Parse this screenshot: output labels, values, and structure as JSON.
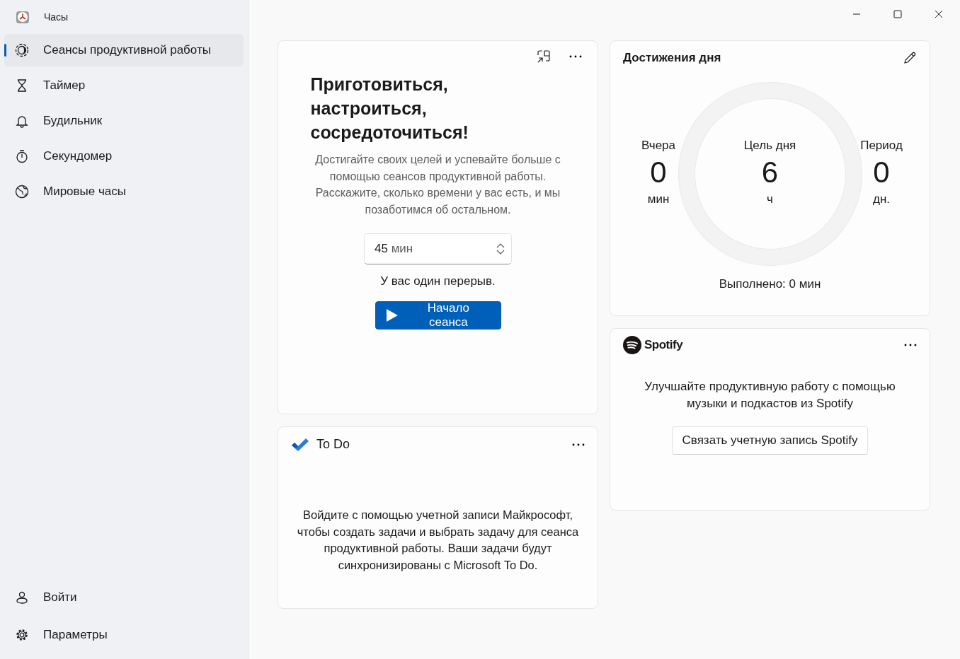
{
  "window": {
    "title": "Часы"
  },
  "sidebar": {
    "items": [
      {
        "label": "Сеансы продуктивной работы",
        "selected": true
      },
      {
        "label": "Таймер",
        "selected": false
      },
      {
        "label": "Будильник",
        "selected": false
      },
      {
        "label": "Секундомер",
        "selected": false
      },
      {
        "label": "Мировые часы",
        "selected": false
      }
    ],
    "footer_items": [
      {
        "label": "Войти"
      },
      {
        "label": "Параметры"
      }
    ]
  },
  "focus_card": {
    "title": "Приготовиться, настроиться, сосредоточиться!",
    "description": "Достигайте своих целей и успевайте больше с помощью сеансов продуктивной работы. Расскажите, сколько времени у вас есть, и мы позаботимся об остальном.",
    "duration_value": "45",
    "duration_unit": "мин",
    "break_info": "У вас один перерыв.",
    "start_button": "Начало сеанса"
  },
  "todo_card": {
    "title": "To Do",
    "message": "Войдите с помощью учетной записи Майкрософт, чтобы создать задачи и выбрать задачу для сеанса продуктивной работы. Ваши задачи будут синхронизированы с Microsoft To Do."
  },
  "daily_card": {
    "title": "Достижения дня",
    "stats": [
      {
        "label": "Вчера",
        "value": "0",
        "unit": "мин"
      },
      {
        "label": "Цель дня",
        "value": "6",
        "unit": "ч"
      },
      {
        "label": "Период",
        "value": "0",
        "unit": "дн."
      }
    ],
    "level": 0,
    "completed": "Выполнено: 0 мин"
  },
  "spotify_card": {
    "brand": "Spotify",
    "message": "Улучшайте продуктивную работу с помощью музыки и подкастов из Spotify",
    "link_button": "Связать учетную запись Spotify"
  }
}
